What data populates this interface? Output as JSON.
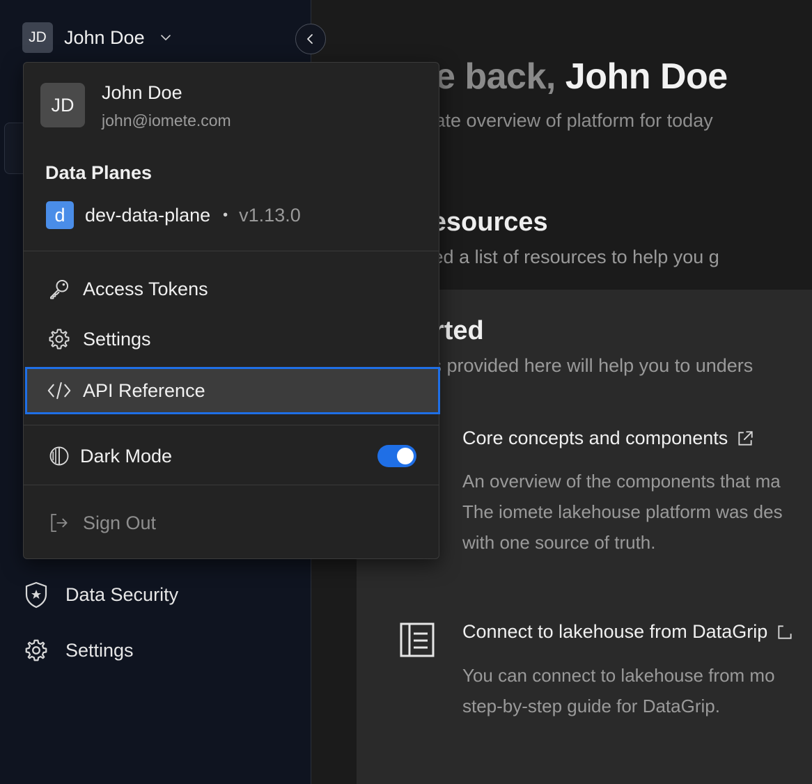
{
  "user": {
    "initials": "JD",
    "name": "John Doe",
    "email": "john@iomete.com"
  },
  "sidebar": {
    "items": [
      {
        "label": "Data Security",
        "icon": "shield-star-icon"
      },
      {
        "label": "Settings",
        "icon": "gear-icon"
      }
    ]
  },
  "main": {
    "greeting": "ome back,",
    "greeting_name": "John Doe",
    "subtitle": "uick state overview of platform for today",
    "resources_title": "ng resources",
    "resources_subtitle": "provided a list of resources to help you g",
    "getting_started_title": "started",
    "getting_started_subtitle": "urces provided here will help you to unders",
    "cards": [
      {
        "title": "Core concepts and components",
        "lines": [
          "An overview of the components that ma",
          "The iomete lakehouse platform was des",
          "with one source of truth."
        ]
      },
      {
        "title": "Connect to lakehouse from DataGrip",
        "lines": [
          "You can connect to lakehouse from mo",
          "step-by-step guide for DataGrip."
        ]
      }
    ]
  },
  "menu": {
    "data_planes_heading": "Data Planes",
    "data_plane": {
      "badge": "d",
      "name": "dev-data-plane",
      "separator": "•",
      "version": "v1.13.0"
    },
    "items": [
      {
        "label": "Access Tokens",
        "icon": "key-icon"
      },
      {
        "label": "Settings",
        "icon": "gear-icon"
      },
      {
        "label": "API Reference",
        "icon": "code-icon"
      }
    ],
    "dark_mode": {
      "label": "Dark Mode",
      "enabled": true
    },
    "sign_out": "Sign Out"
  },
  "colors": {
    "accent": "#1f6fe6",
    "sidebar_bg": "#0f1420",
    "menu_bg": "#232323",
    "data_plane_badge": "#4a8de8"
  }
}
